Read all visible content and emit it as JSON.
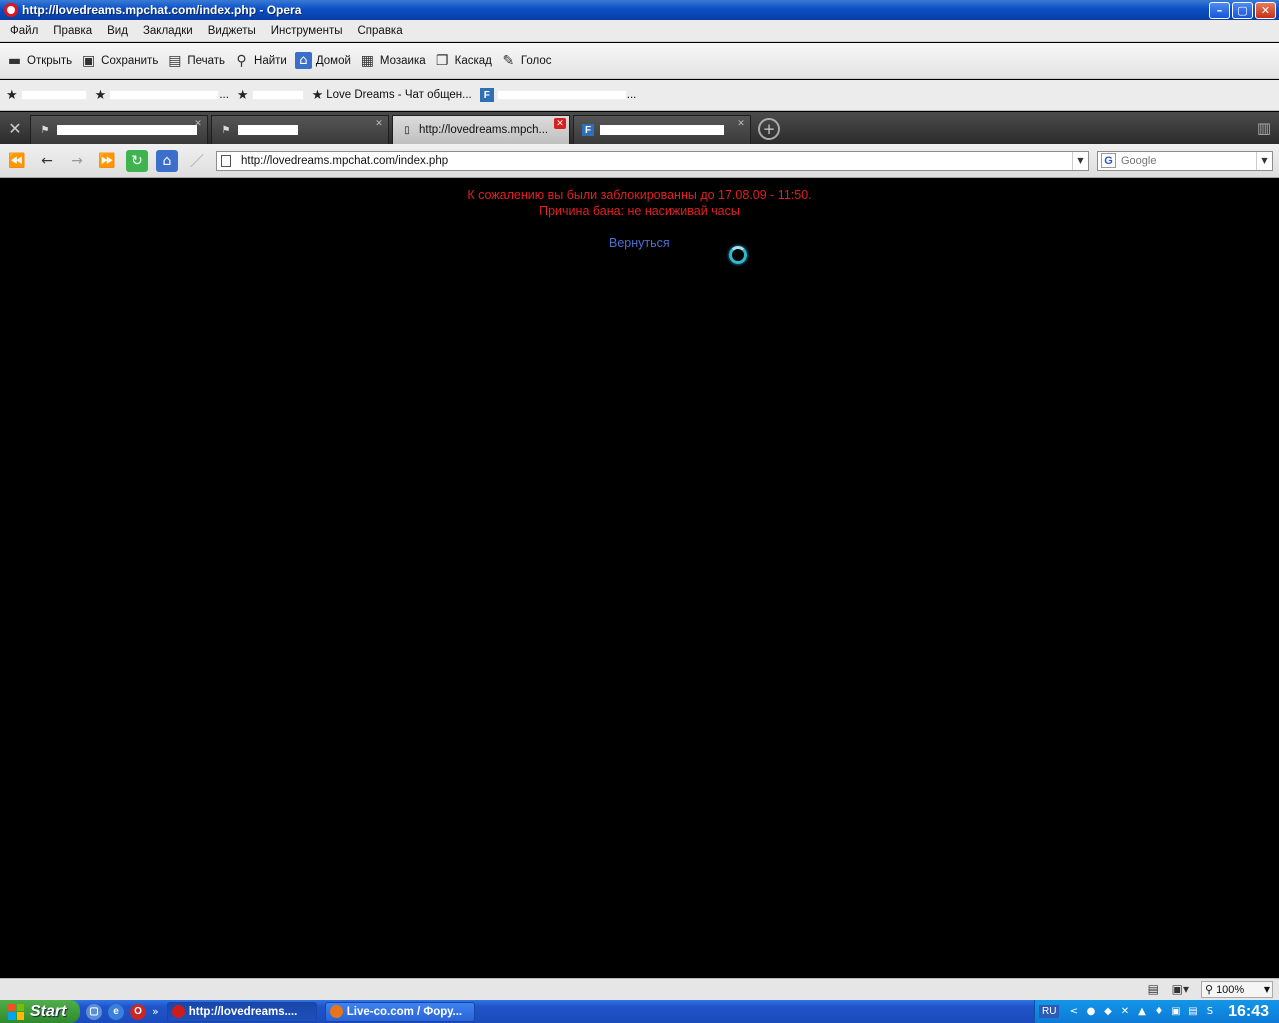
{
  "window": {
    "title": "http://lovedreams.mpchat.com/index.php - Opera",
    "min": "–",
    "max": "▢",
    "close": "✕"
  },
  "menu": [
    "Файл",
    "Правка",
    "Вид",
    "Закладки",
    "Виджеты",
    "Инструменты",
    "Справка"
  ],
  "toolbar": {
    "open": "Открыть",
    "save": "Сохранить",
    "print": "Печать",
    "find": "Найти",
    "home": "Домой",
    "tile": "Мозаика",
    "cascade": "Каскад",
    "voice": "Голос"
  },
  "bookmarks": {
    "item2_suffix": "...",
    "item4": "Love Dreams - Чат общен...",
    "item5_suffix": "..."
  },
  "tabs": {
    "active_title": "http://lovedreams.mpch...",
    "close": "✕"
  },
  "address": {
    "url": "http://lovedreams.mpchat.com/index.php",
    "search_placeholder": "Google"
  },
  "content": {
    "ban_line1": "К сожалению вы были заблокированны до 17.08.09 - 11:50.",
    "ban_line2": "Причина бана: не насиживай часы",
    "back_link": "Вернуться"
  },
  "statusbar": {
    "zoom": "100%"
  },
  "taskbar": {
    "start": "Start",
    "task1": "http://lovedreams....",
    "task2": "Live-co.com / Фору...",
    "lang": "RU",
    "clock": "16:43"
  },
  "colors": {
    "ban_text": "#e31f1f",
    "link": "#4b6fd1",
    "background": "#000000"
  }
}
